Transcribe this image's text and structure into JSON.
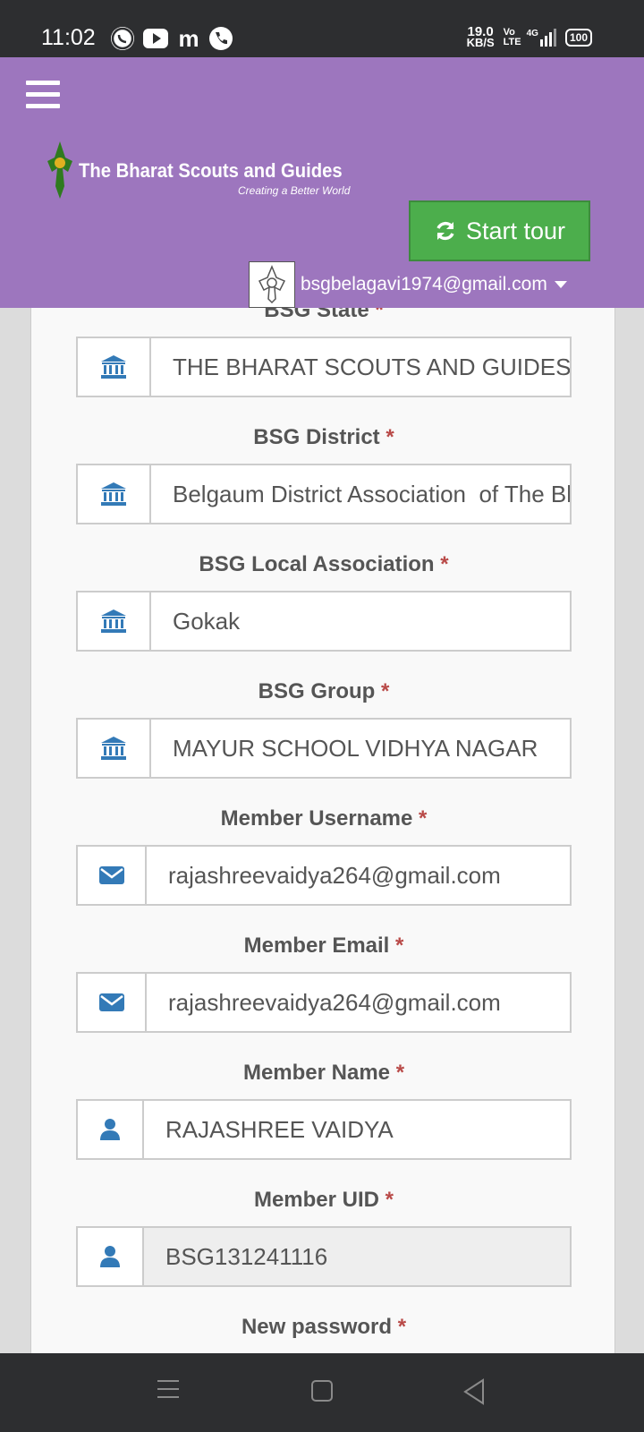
{
  "status_bar": {
    "time": "11:02",
    "apps": [
      "whatsapp-icon",
      "youtube-icon",
      "m-app-icon",
      "phone-icon"
    ],
    "net_speed_value": "19.0",
    "net_speed_unit": "KB/S",
    "volte": "Vo LTE",
    "network": "4G",
    "battery": "100"
  },
  "header": {
    "logo_title": "The Bharat Scouts and Guides",
    "logo_tagline": "Creating a Better World",
    "tour_button": "Start tour",
    "user_email": "bsgbelagavi1974@gmail.com"
  },
  "form": {
    "required_marker": "*",
    "fields": [
      {
        "label": "BSG State",
        "value": "THE BHARAT SCOUTS AND GUIDES",
        "icon": "bank-icon"
      },
      {
        "label": "BSG District",
        "value": "Belgaum District Association  of The Bharat Scouts and Guides",
        "icon": "bank-icon"
      },
      {
        "label": "BSG Local Association",
        "value": "Gokak",
        "icon": "bank-icon"
      },
      {
        "label": "BSG Group",
        "value": "MAYUR SCHOOL VIDHYA NAGAR",
        "icon": "bank-icon"
      },
      {
        "label": "Member Username",
        "value": "rajashreevaidya264@gmail.com",
        "icon": "envelope-icon"
      },
      {
        "label": "Member Email",
        "value": "rajashreevaidya264@gmail.com",
        "icon": "envelope-icon"
      },
      {
        "label": "Member Name",
        "value": "RAJASHREE VAIDYA",
        "icon": "user-icon"
      },
      {
        "label": "Member UID",
        "value": "BSG131241116",
        "icon": "user-icon"
      },
      {
        "label": "New password"
      }
    ]
  },
  "colors": {
    "header": "#9d76be",
    "tour_button": "#4cae4c",
    "icon": "#337ab7",
    "required": "#b94a48"
  }
}
